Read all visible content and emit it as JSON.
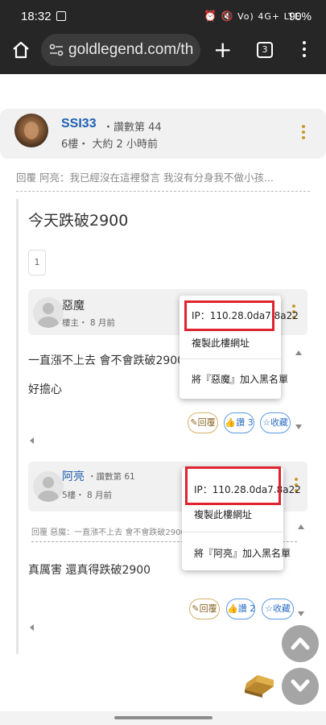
{
  "status_bar": {
    "time": "18:32",
    "icons_text": "Vo) 4G+ LTE",
    "battery": "90%"
  },
  "browser": {
    "url": "goldlegend.com/th",
    "tab_count": "3"
  },
  "post": {
    "author": "SSI33",
    "likes": "・讚數第 44",
    "meta": "6樓・ 大約 2 小時前",
    "reply_quote": "回覆 阿亮：我已經沒在這裡發言 我沒有分身我不做小孩..."
  },
  "thread": {
    "title": "今天跌破2900",
    "page": "1"
  },
  "comment1": {
    "name": "惡魔",
    "meta": "樓主・ 8 月前",
    "line1": "一直漲不上去 會不會跌破2900",
    "line2": "好擔心",
    "reply_label": "回覆",
    "like_label": "讚 3",
    "fav_label": "收藏"
  },
  "popup1": {
    "ip": "IP：110.28.0da7.8a22",
    "copy": "複製此樓網址",
    "block": "將『惡魔』加入黑名單"
  },
  "comment2": {
    "name": "阿亮",
    "likes": "・讚數第 61",
    "meta": "5樓・ 8 月前",
    "quote": "回覆 惡魔：一直漲不上去 會不會跌破2900好擔心",
    "text": "真厲害 還真得跌破2900",
    "reply_label": "回覆",
    "like_label": "讚 2",
    "fav_label": "收藏"
  },
  "popup2": {
    "ip": "IP：110.28.0da7.8a22",
    "copy": "複製此樓網址",
    "block": "將『阿亮』加入黑名單"
  },
  "colors": {
    "status_bar": "#262626",
    "link_blue": "#1f5fb0",
    "highlight_red": "#e0242f",
    "kebab_gold": "#c89a2c"
  }
}
